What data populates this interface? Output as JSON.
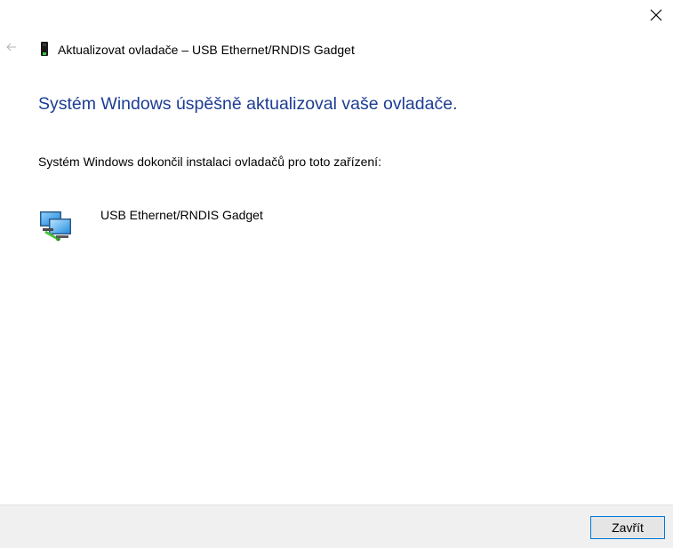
{
  "window": {
    "title": "Aktualizovat ovladače – USB Ethernet/RNDIS Gadget",
    "back_icon": "back-arrow-icon",
    "close_icon": "close-icon",
    "device_icon": "usb-device-icon"
  },
  "main": {
    "heading": "Systém Windows úspěšně aktualizoval vaše ovladače.",
    "heading_color": "#1d3d95",
    "description": "Systém Windows dokončil instalaci ovladačů pro toto zařízení:",
    "device": {
      "name": "USB Ethernet/RNDIS Gadget",
      "icon": "network-adapter-icon"
    }
  },
  "footer": {
    "close_label": "Zavřít",
    "accent": "#0078d7"
  }
}
